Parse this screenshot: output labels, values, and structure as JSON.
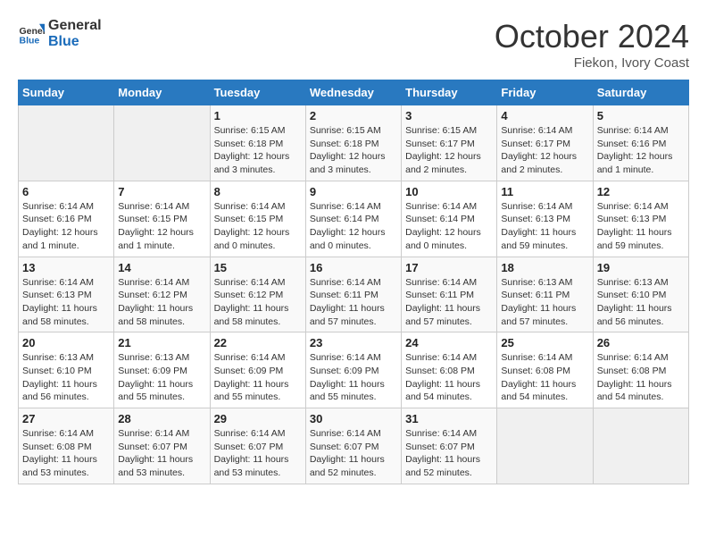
{
  "header": {
    "logo_line1": "General",
    "logo_line2": "Blue",
    "month": "October 2024",
    "location": "Fiekon, Ivory Coast"
  },
  "days_of_week": [
    "Sunday",
    "Monday",
    "Tuesday",
    "Wednesday",
    "Thursday",
    "Friday",
    "Saturday"
  ],
  "weeks": [
    [
      {
        "day": "",
        "detail": ""
      },
      {
        "day": "",
        "detail": ""
      },
      {
        "day": "1",
        "detail": "Sunrise: 6:15 AM\nSunset: 6:18 PM\nDaylight: 12 hours and 3 minutes."
      },
      {
        "day": "2",
        "detail": "Sunrise: 6:15 AM\nSunset: 6:18 PM\nDaylight: 12 hours and 3 minutes."
      },
      {
        "day": "3",
        "detail": "Sunrise: 6:15 AM\nSunset: 6:17 PM\nDaylight: 12 hours and 2 minutes."
      },
      {
        "day": "4",
        "detail": "Sunrise: 6:14 AM\nSunset: 6:17 PM\nDaylight: 12 hours and 2 minutes."
      },
      {
        "day": "5",
        "detail": "Sunrise: 6:14 AM\nSunset: 6:16 PM\nDaylight: 12 hours and 1 minute."
      }
    ],
    [
      {
        "day": "6",
        "detail": "Sunrise: 6:14 AM\nSunset: 6:16 PM\nDaylight: 12 hours and 1 minute."
      },
      {
        "day": "7",
        "detail": "Sunrise: 6:14 AM\nSunset: 6:15 PM\nDaylight: 12 hours and 1 minute."
      },
      {
        "day": "8",
        "detail": "Sunrise: 6:14 AM\nSunset: 6:15 PM\nDaylight: 12 hours and 0 minutes."
      },
      {
        "day": "9",
        "detail": "Sunrise: 6:14 AM\nSunset: 6:14 PM\nDaylight: 12 hours and 0 minutes."
      },
      {
        "day": "10",
        "detail": "Sunrise: 6:14 AM\nSunset: 6:14 PM\nDaylight: 12 hours and 0 minutes."
      },
      {
        "day": "11",
        "detail": "Sunrise: 6:14 AM\nSunset: 6:13 PM\nDaylight: 11 hours and 59 minutes."
      },
      {
        "day": "12",
        "detail": "Sunrise: 6:14 AM\nSunset: 6:13 PM\nDaylight: 11 hours and 59 minutes."
      }
    ],
    [
      {
        "day": "13",
        "detail": "Sunrise: 6:14 AM\nSunset: 6:13 PM\nDaylight: 11 hours and 58 minutes."
      },
      {
        "day": "14",
        "detail": "Sunrise: 6:14 AM\nSunset: 6:12 PM\nDaylight: 11 hours and 58 minutes."
      },
      {
        "day": "15",
        "detail": "Sunrise: 6:14 AM\nSunset: 6:12 PM\nDaylight: 11 hours and 58 minutes."
      },
      {
        "day": "16",
        "detail": "Sunrise: 6:14 AM\nSunset: 6:11 PM\nDaylight: 11 hours and 57 minutes."
      },
      {
        "day": "17",
        "detail": "Sunrise: 6:14 AM\nSunset: 6:11 PM\nDaylight: 11 hours and 57 minutes."
      },
      {
        "day": "18",
        "detail": "Sunrise: 6:13 AM\nSunset: 6:11 PM\nDaylight: 11 hours and 57 minutes."
      },
      {
        "day": "19",
        "detail": "Sunrise: 6:13 AM\nSunset: 6:10 PM\nDaylight: 11 hours and 56 minutes."
      }
    ],
    [
      {
        "day": "20",
        "detail": "Sunrise: 6:13 AM\nSunset: 6:10 PM\nDaylight: 11 hours and 56 minutes."
      },
      {
        "day": "21",
        "detail": "Sunrise: 6:13 AM\nSunset: 6:09 PM\nDaylight: 11 hours and 55 minutes."
      },
      {
        "day": "22",
        "detail": "Sunrise: 6:14 AM\nSunset: 6:09 PM\nDaylight: 11 hours and 55 minutes."
      },
      {
        "day": "23",
        "detail": "Sunrise: 6:14 AM\nSunset: 6:09 PM\nDaylight: 11 hours and 55 minutes."
      },
      {
        "day": "24",
        "detail": "Sunrise: 6:14 AM\nSunset: 6:08 PM\nDaylight: 11 hours and 54 minutes."
      },
      {
        "day": "25",
        "detail": "Sunrise: 6:14 AM\nSunset: 6:08 PM\nDaylight: 11 hours and 54 minutes."
      },
      {
        "day": "26",
        "detail": "Sunrise: 6:14 AM\nSunset: 6:08 PM\nDaylight: 11 hours and 54 minutes."
      }
    ],
    [
      {
        "day": "27",
        "detail": "Sunrise: 6:14 AM\nSunset: 6:08 PM\nDaylight: 11 hours and 53 minutes."
      },
      {
        "day": "28",
        "detail": "Sunrise: 6:14 AM\nSunset: 6:07 PM\nDaylight: 11 hours and 53 minutes."
      },
      {
        "day": "29",
        "detail": "Sunrise: 6:14 AM\nSunset: 6:07 PM\nDaylight: 11 hours and 53 minutes."
      },
      {
        "day": "30",
        "detail": "Sunrise: 6:14 AM\nSunset: 6:07 PM\nDaylight: 11 hours and 52 minutes."
      },
      {
        "day": "31",
        "detail": "Sunrise: 6:14 AM\nSunset: 6:07 PM\nDaylight: 11 hours and 52 minutes."
      },
      {
        "day": "",
        "detail": ""
      },
      {
        "day": "",
        "detail": ""
      }
    ]
  ]
}
